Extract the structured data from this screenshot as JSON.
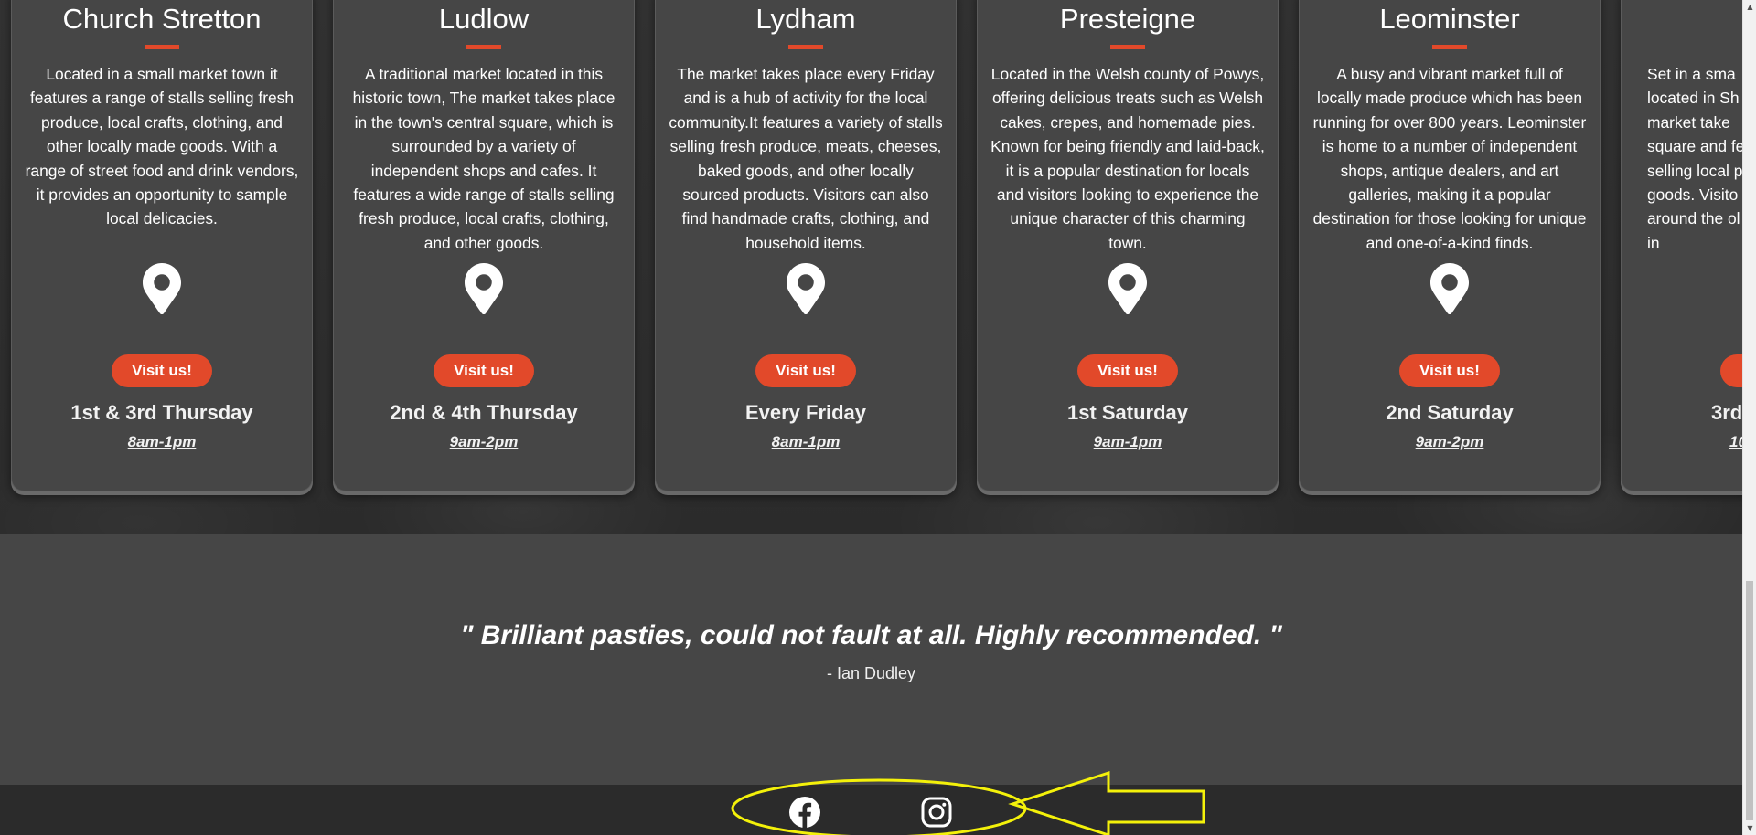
{
  "markets": [
    {
      "name": "Church Stretton",
      "description": "Located in a small market town it features a range of stalls selling fresh produce, local crafts, clothing, and other locally made goods. With a range of street food and drink vendors, it provides an opportunity to sample local delicacies.",
      "button": "Visit us!",
      "day": "1st & 3rd Thursday",
      "time": "8am-1pm"
    },
    {
      "name": "Ludlow",
      "description": "A traditional market located in this historic town, The market takes place in the town's central square, which is surrounded by a variety of independent shops and cafes. It features a wide range of stalls selling fresh produce, local crafts, clothing, and other goods.",
      "button": "Visit us!",
      "day": "2nd & 4th Thursday",
      "time": "9am-2pm"
    },
    {
      "name": "Lydham",
      "description": "The market takes place every Friday and is a hub of activity for the local community.It features a variety of stalls selling fresh produce, meats, cheeses, baked goods, and other locally sourced products. Visitors can also find handmade crafts, clothing, and household items.",
      "button": "Visit us!",
      "day": "Every Friday",
      "time": "8am-1pm"
    },
    {
      "name": "Presteigne",
      "description": "Located in the Welsh county of Powys, offering delicious treats such as Welsh cakes, crepes, and homemade pies. Known for being friendly and laid-back, it is a popular destination for locals and visitors looking to experience the unique character of this charming town.",
      "button": "Visit us!",
      "day": "1st Saturday",
      "time": "9am-1pm"
    },
    {
      "name": "Leominster",
      "description": "A busy and vibrant market full of locally made produce which has been running for over 800 years. Leominster is home to a number of independent shops, antique dealers, and art galleries, making it a popular destination for those looking for unique and one-of-a-kind finds.",
      "button": "Visit us!",
      "day": "2nd Saturday",
      "time": "9am-2pm"
    },
    {
      "name": "",
      "description": "Set in a sma\nlocated in Sh\nmarket take\nsquare and fe\nselling local pr\ngoods. Visito\naround the ol\nin",
      "button": "",
      "day": "3rd",
      "time": "10"
    }
  ],
  "testimonial": {
    "quote": "\" Brilliant pasties, could not fault at all. Highly recommended. \"",
    "author": "- Ian Dudley"
  },
  "footer": {
    "social_icons": [
      "facebook-icon",
      "instagram-icon"
    ]
  },
  "colors": {
    "accent": "#e2492a",
    "card": "#464646",
    "testimonial_bg": "#464646",
    "footer_bg": "#2b2b2b",
    "annotation": "#f4f10a"
  }
}
